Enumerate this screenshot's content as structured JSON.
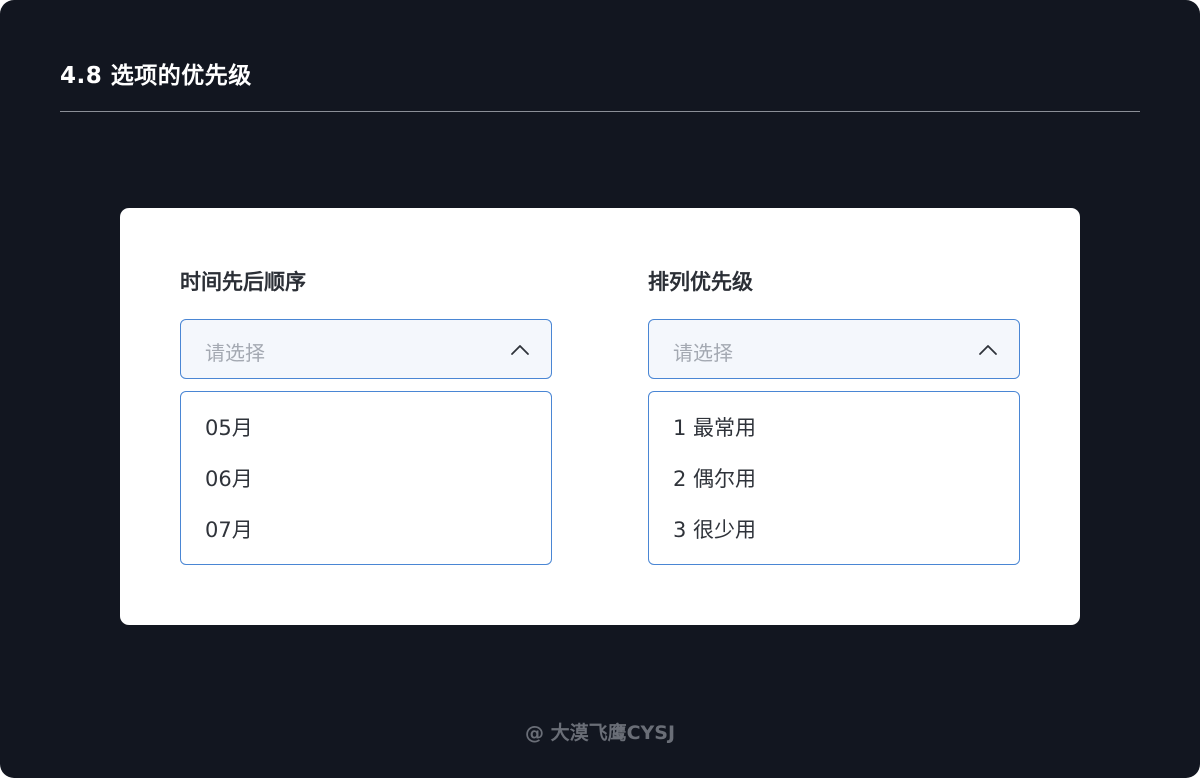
{
  "section_title": "4.8 选项的优先级",
  "colors": {
    "page_background": "#121620",
    "card_background": "#ffffff",
    "select_border": "#4a86d4",
    "select_fill": "#f4f7fc",
    "placeholder_text": "#a4a9b2",
    "option_text": "#2f333a"
  },
  "left_select": {
    "label": "时间先后顺序",
    "placeholder": "请选择",
    "icon": "chevron-up-icon",
    "options": [
      "05月",
      "06月",
      "07月"
    ]
  },
  "right_select": {
    "label": "排列优先级",
    "placeholder": "请选择",
    "icon": "chevron-up-icon",
    "options": [
      "1 最常用",
      "2 偶尔用",
      "3 很少用"
    ]
  },
  "footer_credit": "@ 大漠飞鹰CYSJ"
}
